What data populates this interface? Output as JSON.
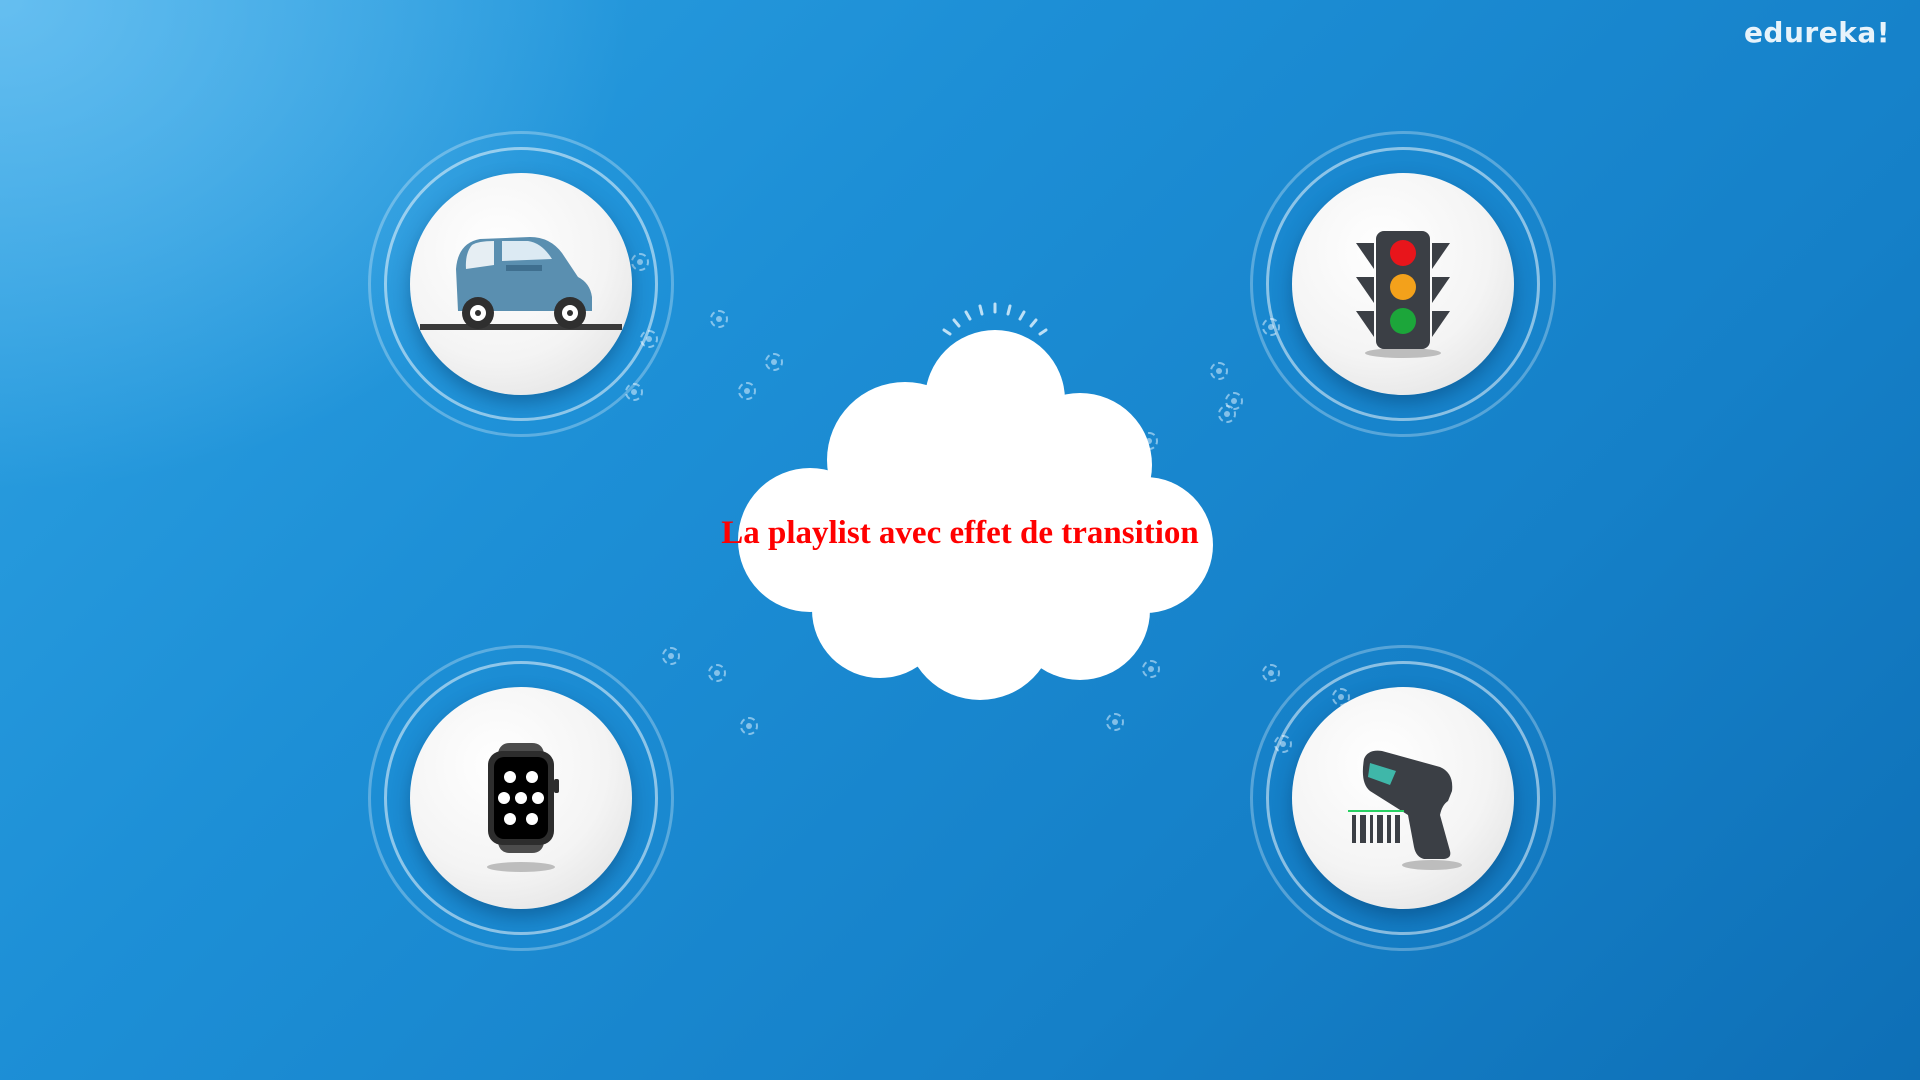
{
  "brand": {
    "logo_text": "edureka!"
  },
  "center": {
    "caption": "La playlist avec effet de transition"
  },
  "orbs": [
    {
      "icon": "car-icon"
    },
    {
      "icon": "traffic-light-icon"
    },
    {
      "icon": "smartwatch-icon"
    },
    {
      "icon": "barcode-scanner-icon"
    }
  ],
  "colors": {
    "background": "#1a8ad0",
    "caption": "#ff0000",
    "traffic_red": "#e8151b",
    "traffic_amber": "#f3a11b",
    "traffic_green": "#1ca63a",
    "car_body": "#5a8fb0"
  }
}
